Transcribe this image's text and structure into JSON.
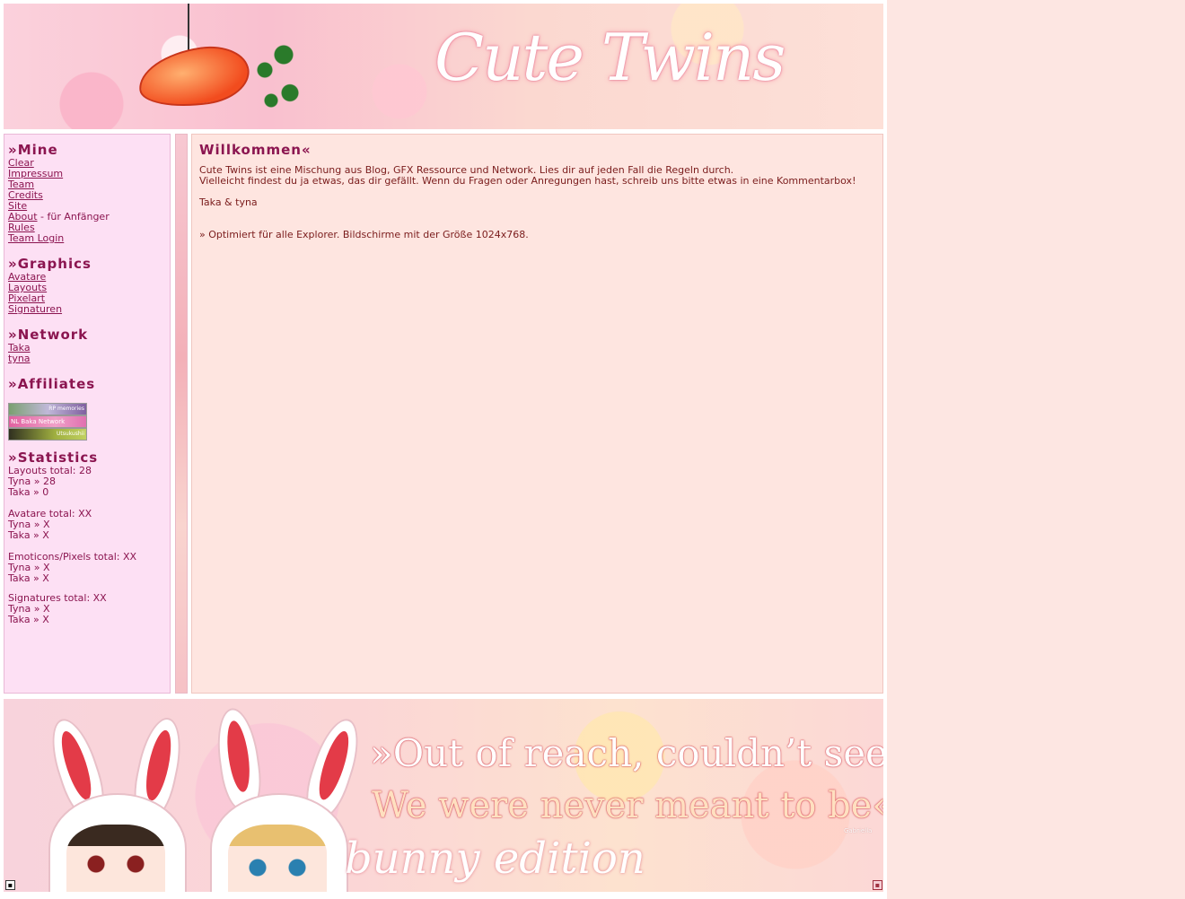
{
  "header": {
    "logo_text": "Cute Twins"
  },
  "sidebar": {
    "mine": {
      "arrow": "»",
      "title": "Mine",
      "links": [
        "Clear",
        "Impressum",
        "Team",
        "Credits",
        "Site",
        "About",
        "Rules",
        "Team Login"
      ],
      "about_suffix": " - für Anfänger"
    },
    "graphics": {
      "arrow": "»",
      "title": "Graphics",
      "links": [
        "Avatare",
        "Layouts",
        "Pixelart",
        "Signaturen"
      ]
    },
    "network": {
      "arrow": "»",
      "title": "Network",
      "links": [
        "Taka",
        "tyna"
      ]
    },
    "affiliates": {
      "arrow": "»",
      "title": "Affiliates",
      "buttons": [
        "RP memories",
        "NL Baka Network",
        "Utsukushii"
      ]
    },
    "statistics": {
      "arrow": "»",
      "title": "Statistics",
      "groups": [
        [
          "Layouts total: 28",
          "Tyna » 28",
          "Taka » 0"
        ],
        [
          "Avatare total: XX",
          "Tyna » X",
          "Taka » X"
        ],
        [
          "Emoticons/Pixels total: XX",
          "Tyna » X",
          "Taka » X"
        ],
        [
          "Signatures total: XX",
          "Tyna » X",
          "Taka » X"
        ]
      ]
    }
  },
  "main": {
    "title": "Willkommen«",
    "line1": "Cute Twins ist eine Mischung aus Blog, GFX Ressource und Network. Lies dir auf jeden Fall die Regeln durch.",
    "line2": "Vielleicht findest du ja etwas, das dir gefällt. Wenn du Fragen oder Anregungen hast, schreib uns bitte etwas in eine Kommentarbox!",
    "signature": "Taka & tyna",
    "note": "» Optimiert für alle Explorer. Bildschirme mit der Größe 1024x768."
  },
  "footer": {
    "quote_line1": "»Out of reach, couldn’t see.",
    "quote_line2": "We were never meant to be«",
    "edition": "bunny edition",
    "credit": "Gabriella"
  },
  "colors": {
    "page_bg": "#fde6e2",
    "sidebar_bg": "#fde0f4",
    "main_bg": "#fee5e0",
    "heading": "#8b1550",
    "text": "#7a1c1c"
  }
}
